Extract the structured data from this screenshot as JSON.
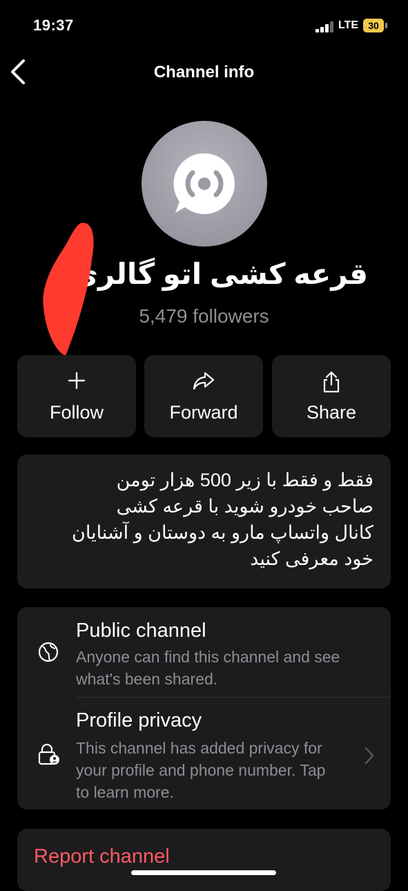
{
  "status": {
    "time": "19:37",
    "network": "LTE",
    "battery": "30"
  },
  "nav": {
    "title": "Channel info",
    "back_icon": "chevron-left-icon"
  },
  "channel": {
    "name": "قرعه کشی اتو گالری",
    "followers": "5,479 followers"
  },
  "actions": [
    {
      "label": "Follow",
      "icon": "plus-icon"
    },
    {
      "label": "Forward",
      "icon": "forward-arrow-icon"
    },
    {
      "label": "Share",
      "icon": "share-icon"
    }
  ],
  "description": "فقط و فقط با زیر  500 هزار تومن\nصاحب خودرو شوید با قرعه کشی\nکانال واتساپ مارو به دوستان و آشنایان\nخود معرفی کنید",
  "info": {
    "public": {
      "title": "Public channel",
      "subtitle": "Anyone can find this channel and see\nwhat's been shared.",
      "icon": "globe-icon"
    },
    "privacy": {
      "title": "Profile privacy",
      "subtitle": "This channel has added privacy for\nyour profile and phone number. Tap\nto learn more.",
      "icon": "lock-person-icon"
    }
  },
  "report": {
    "label": "Report channel"
  },
  "colors": {
    "background": "#000000",
    "card": "#1c1c1e",
    "danger": "#ff5a63",
    "muted": "#8e8e93",
    "battery": "#f2c94c"
  }
}
